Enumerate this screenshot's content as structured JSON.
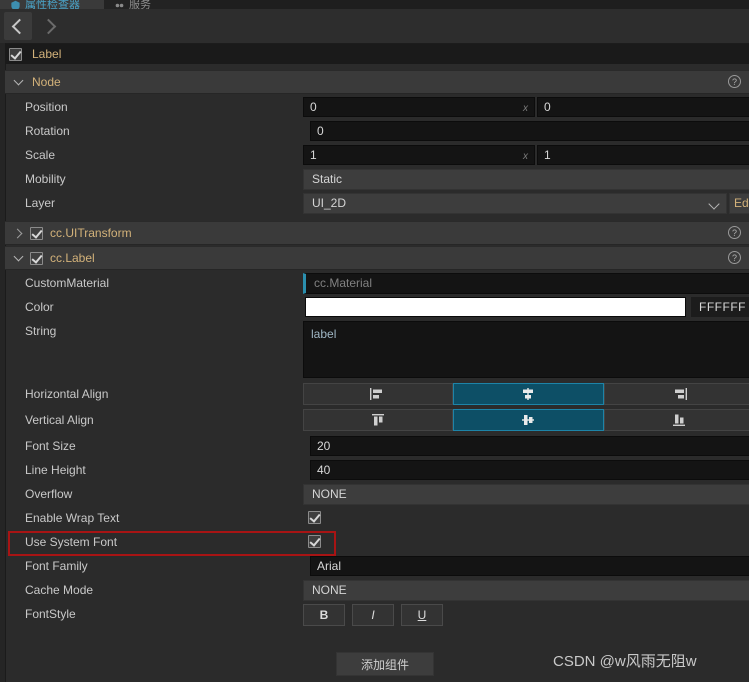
{
  "window": {
    "tabs": [
      {
        "label": "属性检查器",
        "icon": "inspector-icon",
        "active": true
      },
      {
        "label": "服务",
        "icon": "services-icon",
        "active": false
      }
    ]
  },
  "navbar": {
    "back_icon": "chevron-left-icon",
    "forward_icon": "chevron-right-icon"
  },
  "node_header": {
    "enabled": true,
    "name": "Label"
  },
  "sections": [
    {
      "id": "node",
      "title": "Node",
      "expanded": true,
      "has_checkbox": false,
      "help_icon": "help-circle-icon"
    },
    {
      "id": "ui-transform",
      "title": "cc.UITransform",
      "expanded": false,
      "has_checkbox": true,
      "checked": true,
      "help_icon": "help-circle-icon"
    },
    {
      "id": "label",
      "title": "cc.Label",
      "expanded": true,
      "has_checkbox": true,
      "checked": true,
      "help_icon": "help-circle-icon"
    }
  ],
  "node_props": {
    "position": {
      "label": "Position",
      "x": "0",
      "y": "0",
      "suffix_x": "x"
    },
    "rotation": {
      "label": "Rotation",
      "value": "0"
    },
    "scale": {
      "label": "Scale",
      "x": "1",
      "y": "1",
      "suffix_x": "x"
    },
    "mobility": {
      "label": "Mobility",
      "value": "Static"
    },
    "layer": {
      "label": "Layer",
      "value": "UI_2D",
      "edit_button": "Ed"
    }
  },
  "label_props": {
    "custom_material": {
      "label": "CustomMaterial",
      "placeholder": "cc.Material"
    },
    "color": {
      "label": "Color",
      "swatch": "#FFFFFF",
      "hex": "FFFFFF"
    },
    "string": {
      "label": "String",
      "value": "label"
    },
    "horizontal_align": {
      "label": "Horizontal Align",
      "options": [
        "align-left-icon",
        "align-center-icon",
        "align-right-icon"
      ],
      "selected": 1
    },
    "vertical_align": {
      "label": "Vertical Align",
      "options": [
        "align-top-icon",
        "align-middle-icon",
        "align-bottom-icon"
      ],
      "selected": 1
    },
    "font_size": {
      "label": "Font Size",
      "value": "20"
    },
    "line_height": {
      "label": "Line Height",
      "value": "40"
    },
    "overflow": {
      "label": "Overflow",
      "value": "NONE"
    },
    "enable_wrap_text": {
      "label": "Enable Wrap Text",
      "checked": true
    },
    "use_system_font": {
      "label": "Use System Font",
      "checked": true,
      "highlighted": true
    },
    "font_family": {
      "label": "Font Family",
      "value": "Arial"
    },
    "cache_mode": {
      "label": "Cache Mode",
      "value": "NONE"
    },
    "font_style": {
      "label": "FontStyle",
      "buttons": [
        "B",
        "I",
        "U"
      ]
    }
  },
  "footer": {
    "add_component": "添加组件"
  },
  "watermark": "CSDN @w风雨无阻w",
  "colors": {
    "accent": "#0d4f66",
    "accent_border": "#1d84a8",
    "section_title": "#d3b27a",
    "annotation": "#a81414",
    "panel_bg": "#2b2b2b"
  }
}
